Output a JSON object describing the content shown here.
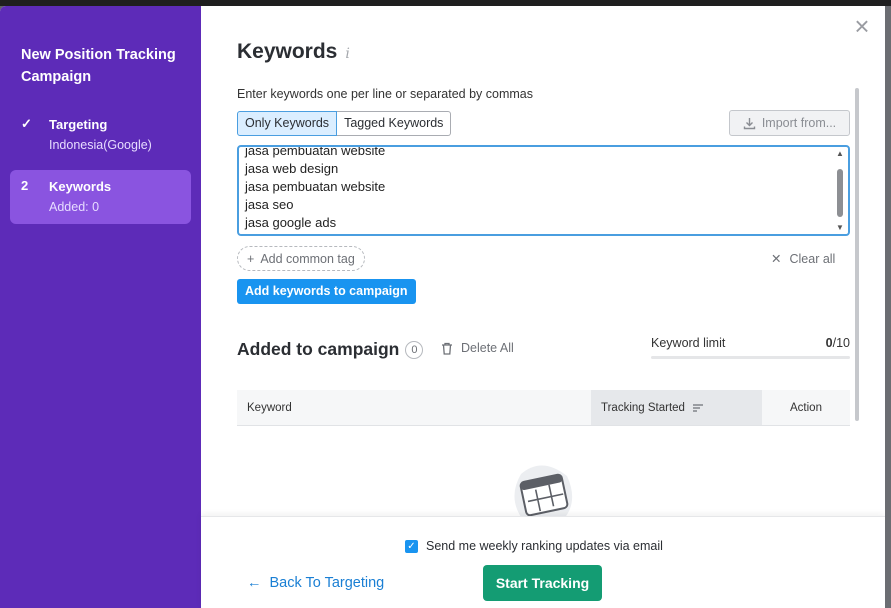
{
  "sidebar": {
    "title": "New Position Tracking Campaign",
    "steps": [
      {
        "marker": "✓",
        "label": "Targeting",
        "sub": "Indonesia(Google)"
      },
      {
        "marker": "2",
        "label": "Keywords",
        "sub": "Added: 0"
      }
    ]
  },
  "header": {
    "title": "Keywords",
    "info_icon": "i"
  },
  "keywords": {
    "hint": "Enter keywords one per line or separated by commas",
    "tab_only": "Only Keywords",
    "tab_tagged": "Tagged Keywords",
    "import_label": "Import from...",
    "lines": [
      "jasa pembuatan website",
      "jasa web design",
      "jasa pembuatan website",
      "jasa seo",
      "jasa google ads"
    ],
    "add_tag_label": "Add common tag",
    "clear_label": "Clear all",
    "add_button": "Add keywords to campaign"
  },
  "added": {
    "title": "Added to campaign",
    "count": "0",
    "delete_label": "Delete All",
    "limit_label": "Keyword limit",
    "limit_used": "0",
    "limit_total": "/10"
  },
  "table": {
    "columns": [
      "Keyword",
      "Tracking Started",
      "Action"
    ]
  },
  "footer": {
    "email_label": "Send me weekly ranking updates via email",
    "back_label": "Back To Targeting",
    "start_label": "Start Tracking"
  },
  "colors": {
    "sidebar": "#5d2bb8",
    "accent": "#1994f0",
    "start": "#149c73"
  }
}
